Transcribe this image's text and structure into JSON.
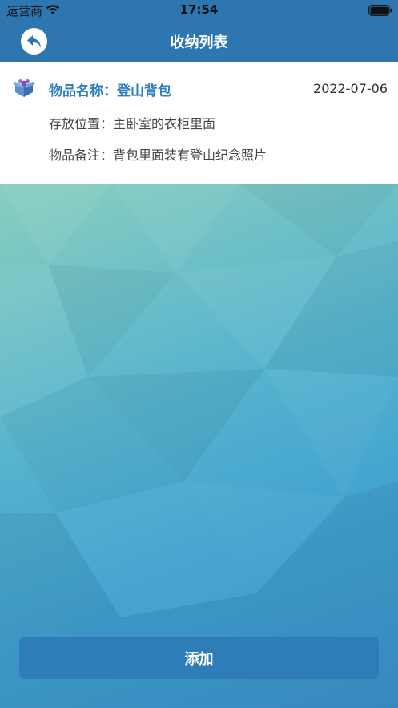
{
  "status_bar": {
    "carrier": "运营商",
    "time": "17:54"
  },
  "nav": {
    "title": "收纳列表",
    "back_icon": "back-arrow-icon"
  },
  "item": {
    "icon": "box-icon",
    "name_label": "物品名称：",
    "name_value": "登山背包",
    "date": "2022-07-06",
    "location_label": "存放位置：",
    "location_value": "主卧室的衣柜里面",
    "note_label": "物品备注：",
    "note_value": "背包里面装有登山纪念照片"
  },
  "add_button": {
    "label": "添加"
  },
  "colors": {
    "header": "#2e76b0",
    "accent": "#2e7fbd",
    "button": "#2f7db8"
  }
}
